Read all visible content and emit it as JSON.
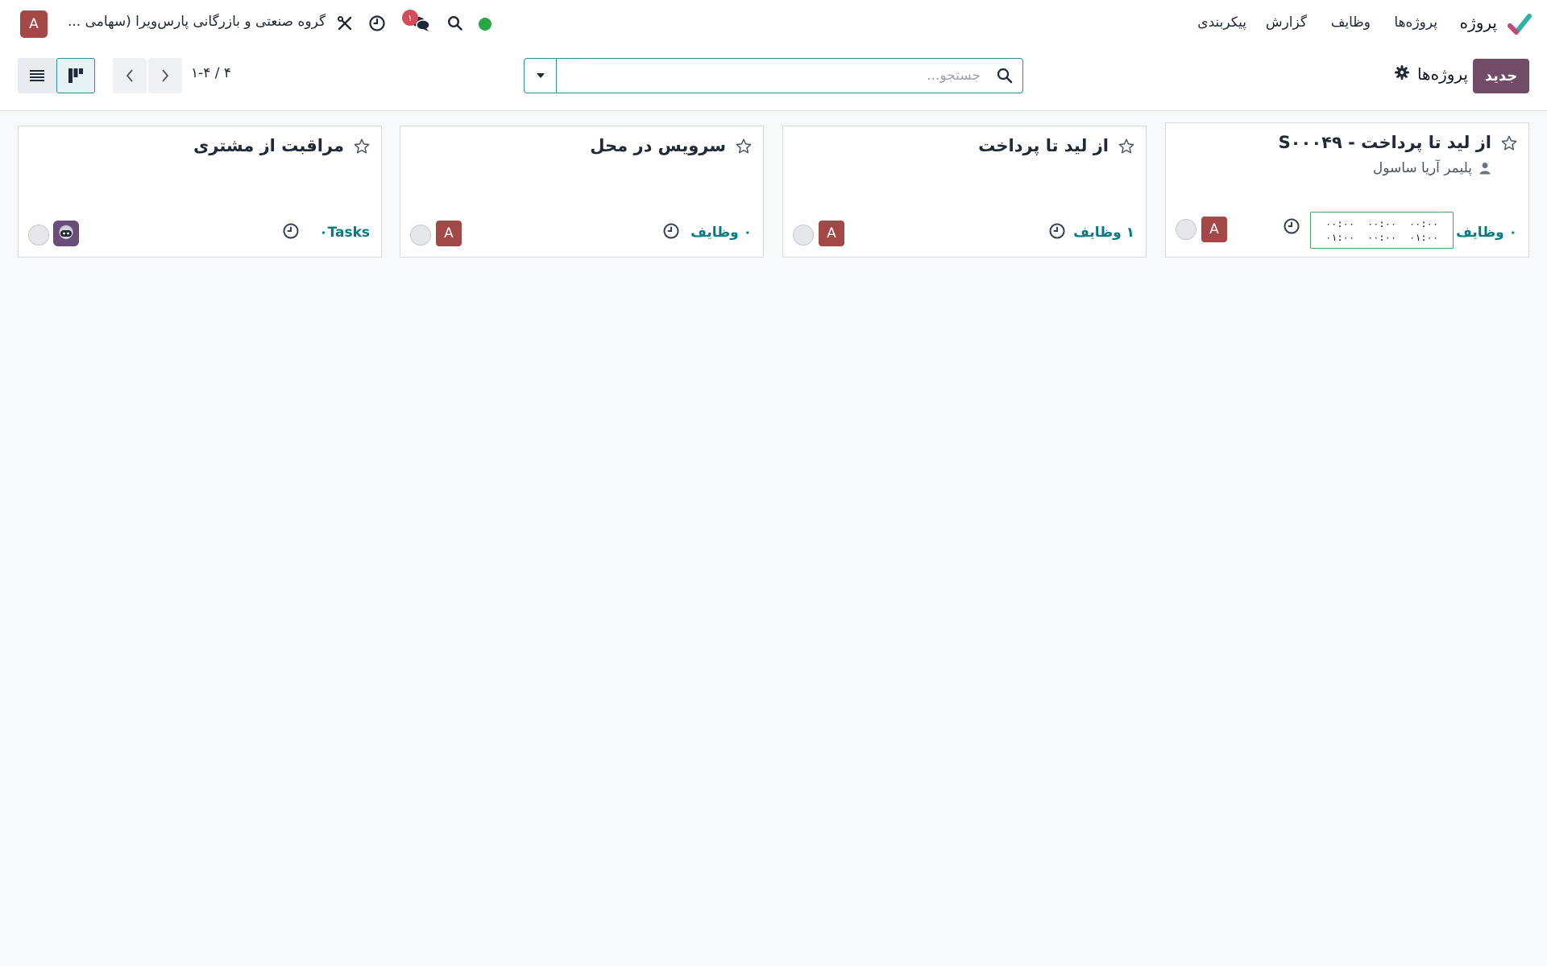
{
  "navbar": {
    "app_name": "پروژه",
    "menu": [
      "پروژه‌ها",
      "وظایف",
      "گزارش",
      "پیکربندی"
    ],
    "company": "گروه صنعتی و بازرگانی پارس‌ویرا (سهامی ...",
    "user_initial": "A",
    "chat_badge": "۱",
    "icons": [
      "app-logo-icon",
      "tools-icon",
      "clock-icon",
      "chat-icon",
      "search-icon",
      "presence-dot"
    ],
    "presence_color": "#28a745"
  },
  "control": {
    "new_label": "جدید",
    "breadcrumb": "پروژه‌ها",
    "search_placeholder": "جستجو...",
    "pager": "۱-۴ / ۴",
    "active_view": "kanban"
  },
  "cards": [
    {
      "title": "S۰۰۰۴۹ - از لید تا پرداخت",
      "partner": "پلیمر آریا ساسول",
      "tasks": "۰ وظایف",
      "timer": [
        [
          "۰۰:۰۰",
          "۰۰:۰۰",
          "۰۰:۰۰"
        ],
        [
          "۰۱:۰۰",
          "۰۰:۰۰",
          "۰۱:۰۰"
        ]
      ],
      "avatar": "A"
    },
    {
      "title": "از لید تا پرداخت",
      "tasks": "۱ وظایف",
      "avatar": "A"
    },
    {
      "title": "سرویس در محل",
      "tasks": "۰ وظایف",
      "avatar": "A"
    },
    {
      "title": "مراقبت از مشتری",
      "tasks": "۰Tasks",
      "avatar": ""
    }
  ],
  "colors": {
    "primary": "#714b67",
    "accent": "#017e84",
    "avatar": "#a34747",
    "badge": "#d44c59"
  }
}
